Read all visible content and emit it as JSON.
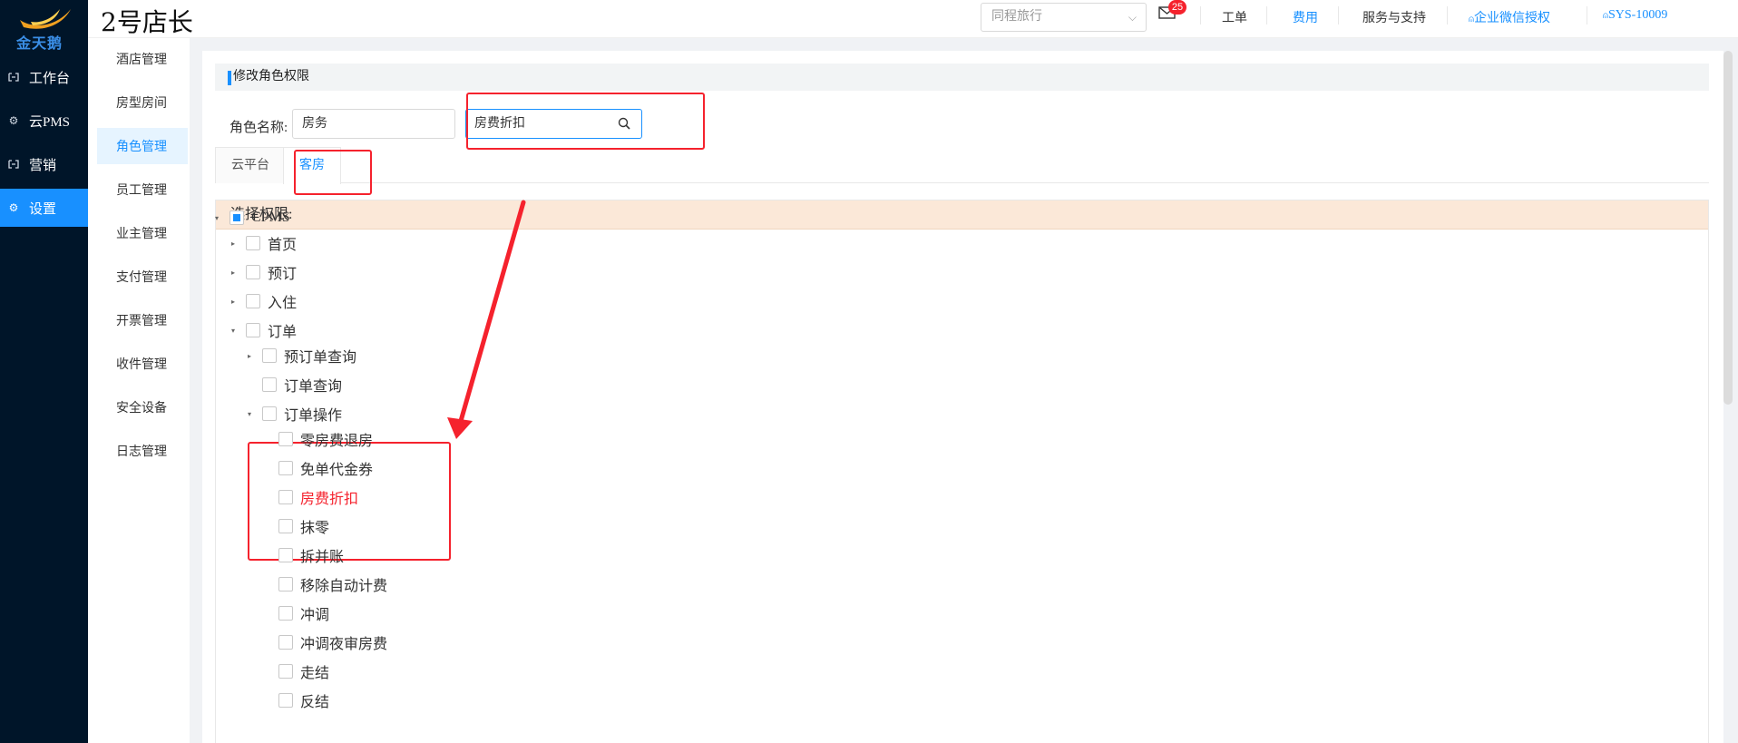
{
  "brand": {
    "logo_text": "金天鹅",
    "store_name": "2号店长"
  },
  "main_nav": [
    {
      "label": "工作台",
      "icon": "workbench-icon",
      "active": false
    },
    {
      "label": "云PMS",
      "icon": "gear-icon",
      "active": false
    },
    {
      "label": "营销",
      "icon": "marketing-icon",
      "active": false
    },
    {
      "label": "设置",
      "icon": "gear-icon",
      "active": true
    }
  ],
  "sub_nav": [
    {
      "label": "酒店管理",
      "active": false
    },
    {
      "label": "房型房间",
      "active": false
    },
    {
      "label": "角色管理",
      "active": true
    },
    {
      "label": "员工管理",
      "active": false
    },
    {
      "label": "业主管理",
      "active": false
    },
    {
      "label": "支付管理",
      "active": false
    },
    {
      "label": "开票管理",
      "active": false
    },
    {
      "label": "收件管理",
      "active": false
    },
    {
      "label": "安全设备",
      "active": false
    },
    {
      "label": "日志管理",
      "active": false
    }
  ],
  "header": {
    "hotel_select_placeholder": "同程旅行",
    "mail_badge": "25",
    "links": {
      "work_order": "工单",
      "fees": "费用",
      "service_support": "服务与支持",
      "wechat_auth": "企业微信授权",
      "user": "SYS-10009"
    }
  },
  "page": {
    "section_title": "修改角色权限",
    "role_name_label": "角色名称:",
    "role_name_value": "房务",
    "search_value": "房费折扣",
    "tabs": [
      {
        "label": "云平台",
        "active": false
      },
      {
        "label": "客房",
        "active": true
      }
    ],
    "permission_header": "选择权限:"
  },
  "tree": [
    {
      "label": "CPMS",
      "caret": "▾",
      "checked": "partial",
      "red": false
    },
    {
      "label": "首页",
      "caret": "▸",
      "checked": "none",
      "red": false
    },
    {
      "label": "预订",
      "caret": "▸",
      "checked": "none",
      "red": false
    },
    {
      "label": "入住",
      "caret": "▸",
      "checked": "none",
      "red": false
    },
    {
      "label": "订单",
      "caret": "▾",
      "checked": "none",
      "red": false
    },
    {
      "label": "预订单查询",
      "caret": "▸",
      "checked": "none",
      "red": false
    },
    {
      "label": "订单查询",
      "caret": "",
      "checked": "none",
      "red": false
    },
    {
      "label": "订单操作",
      "caret": "▾",
      "checked": "none",
      "red": false
    },
    {
      "label": "零房费退房",
      "caret": "",
      "checked": "none",
      "red": false
    },
    {
      "label": "免单代金券",
      "caret": "",
      "checked": "none",
      "red": false
    },
    {
      "label": "房费折扣",
      "caret": "",
      "checked": "none",
      "red": true
    },
    {
      "label": "抹零",
      "caret": "",
      "checked": "none",
      "red": false
    },
    {
      "label": "拆并账",
      "caret": "",
      "checked": "none",
      "red": false
    },
    {
      "label": "移除自动计费",
      "caret": "",
      "checked": "none",
      "red": false
    },
    {
      "label": "冲调",
      "caret": "",
      "checked": "none",
      "red": false
    },
    {
      "label": "冲调夜审房费",
      "caret": "",
      "checked": "none",
      "red": false
    },
    {
      "label": "走结",
      "caret": "",
      "checked": "none",
      "red": false
    },
    {
      "label": "反结",
      "caret": "",
      "checked": "none",
      "red": false
    }
  ],
  "colors": {
    "sidebar": "#001529",
    "accent": "#1890ff",
    "annotation": "#f5222d",
    "perm_header_bg": "#fbe8d8"
  }
}
